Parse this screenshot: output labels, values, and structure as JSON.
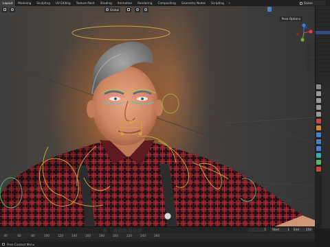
{
  "workspace_tabs": [
    "Layout",
    "Modeling",
    "Sculpting",
    "UV Editing",
    "Texture Paint",
    "Shading",
    "Animation",
    "Rendering",
    "Compositing",
    "Geometry Nodes",
    "Scripting"
  ],
  "active_tab": "Layout",
  "scene_label": "Scene",
  "viewport": {
    "orientation_value": "Global",
    "pose_options_label": "Pose Options"
  },
  "timeline": {
    "current_frame": "1",
    "start_label": "Start",
    "start_value": "1",
    "end_label": "End",
    "end_value": "250",
    "ruler_ticks": [
      "40",
      "60",
      "80",
      "100",
      "120",
      "140",
      "160",
      "180",
      "200",
      "220",
      "240",
      "260"
    ]
  },
  "status_bar": {
    "text": "Pose Context Menu"
  },
  "icons": {
    "gizmo_x_color": "#e0404a",
    "gizmo_y_color": "#6bb339",
    "gizmo_z_color": "#3c7fe0",
    "selection_color": "#334d80"
  }
}
